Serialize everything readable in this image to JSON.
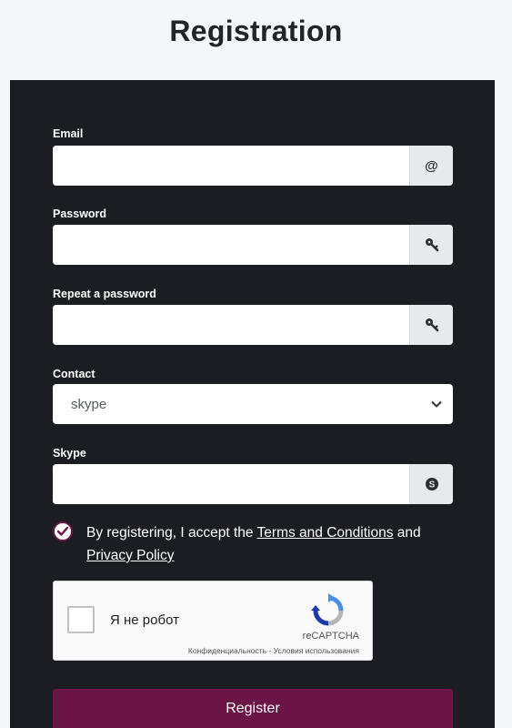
{
  "page": {
    "title": "Registration"
  },
  "form": {
    "email": {
      "label": "Email",
      "value": "",
      "addon": "@"
    },
    "password": {
      "label": "Password",
      "value": ""
    },
    "repeat_password": {
      "label": "Repeat a password",
      "value": ""
    },
    "contact": {
      "label": "Contact",
      "selected": "skype"
    },
    "skype": {
      "label": "Skype",
      "value": ""
    },
    "consent": {
      "checked": true,
      "prefix": "By registering, I accept the ",
      "terms_link": "Terms and Conditions",
      "middle": " and ",
      "privacy_link": "Privacy Policy"
    },
    "captcha": {
      "label": "Я не робот",
      "brand": "reCAPTCHA",
      "links": "Конфиденциальность - Условия использования"
    },
    "register_label": "Register"
  },
  "colors": {
    "panel": "#1b1d22",
    "accent": "#6b1547",
    "background": "#f4f7f9"
  },
  "icons": [
    "at-icon",
    "key-icon",
    "chevron-down-icon",
    "skype-icon",
    "checkmark-icon",
    "recaptcha-logo-icon"
  ]
}
